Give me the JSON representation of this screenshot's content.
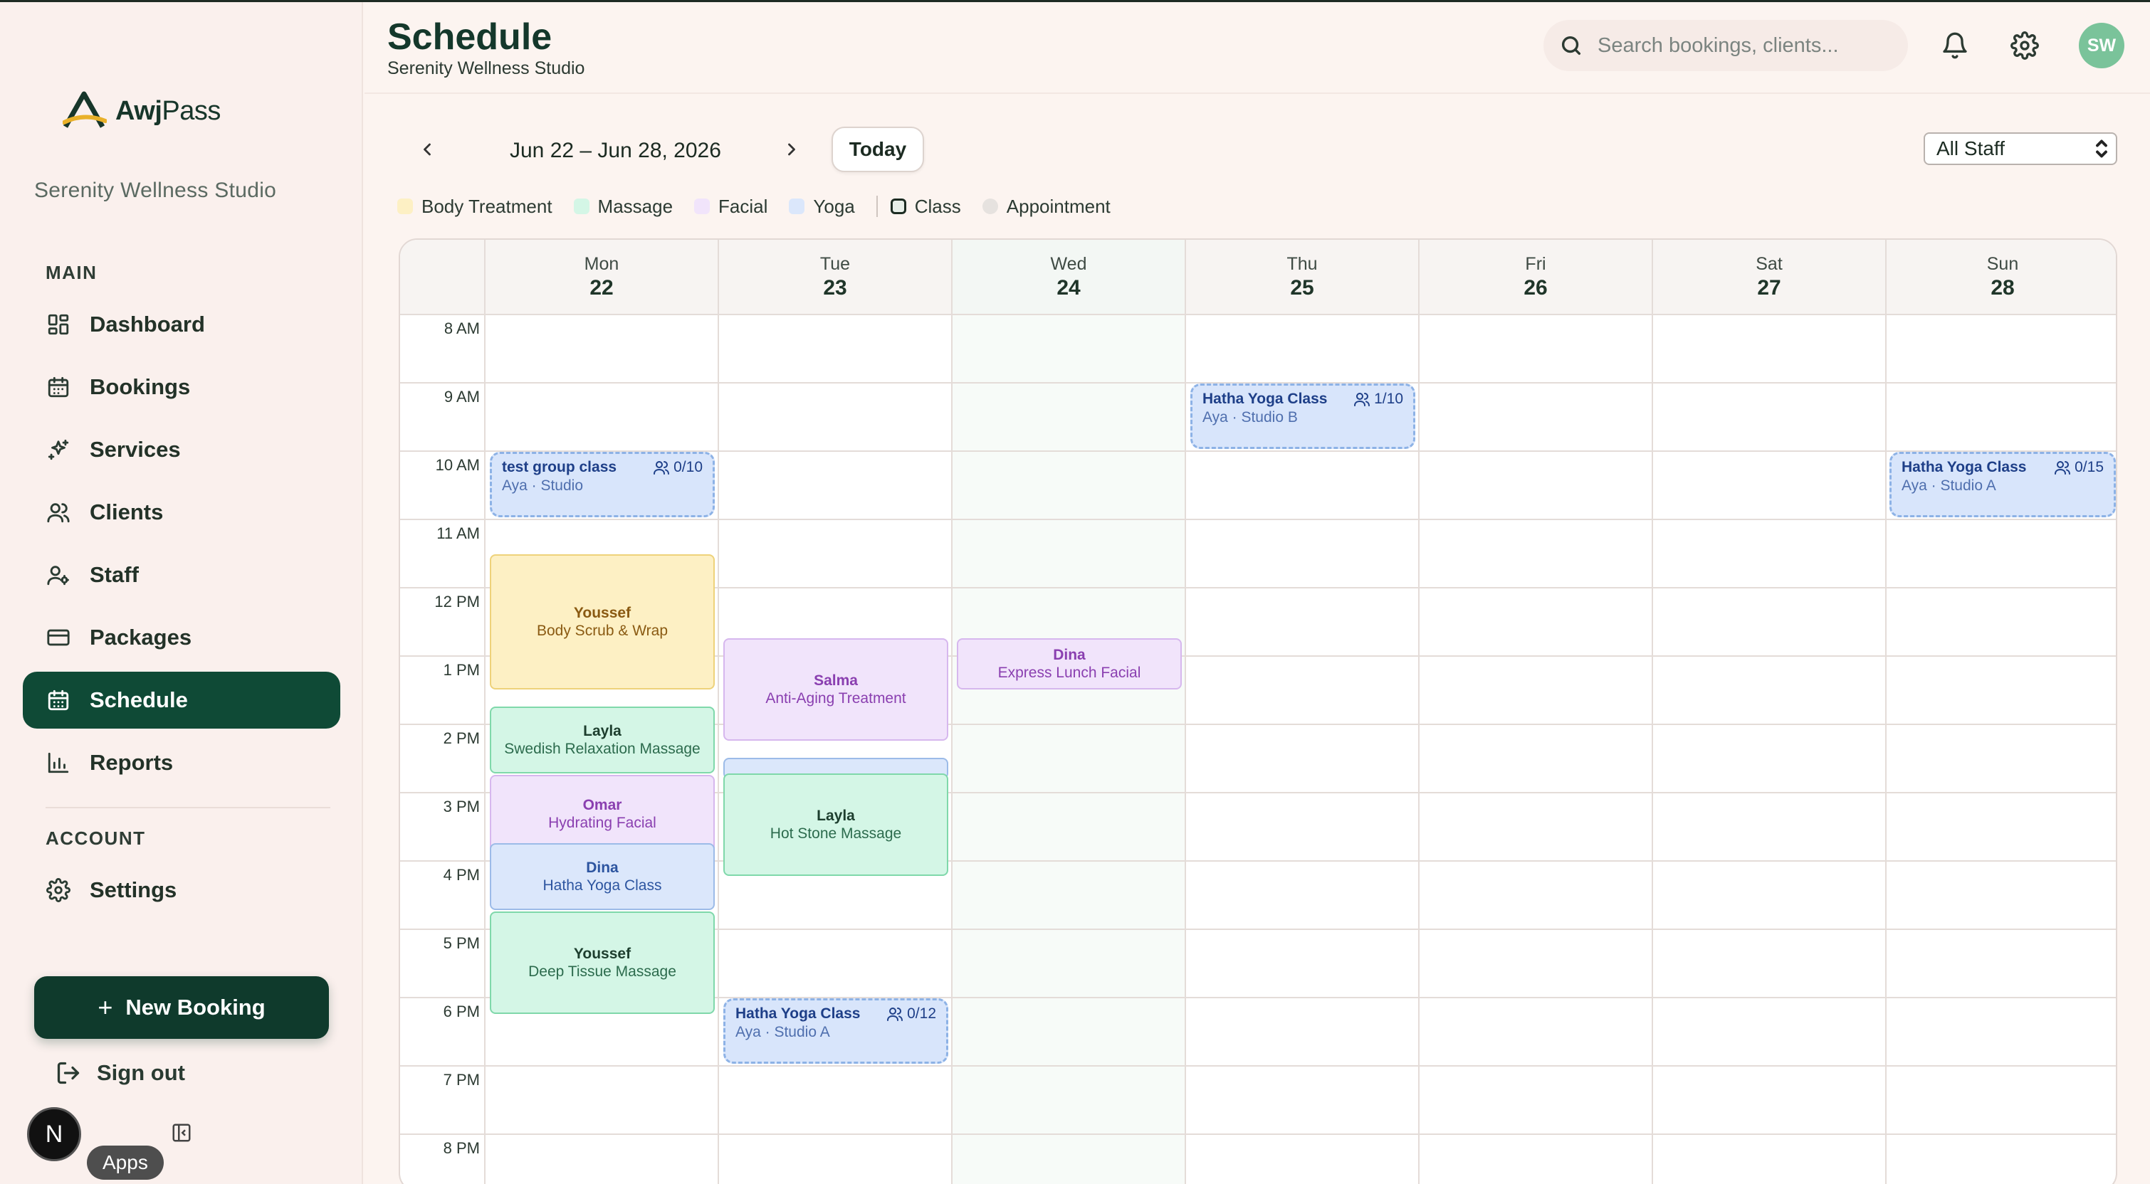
{
  "app": {
    "brand_bold": "Awj",
    "brand_light": "Pass",
    "studio_name": "Serenity Wellness Studio"
  },
  "sidebar": {
    "main_label": "MAIN",
    "account_label": "ACCOUNT",
    "items": [
      {
        "label": "Dashboard",
        "icon": "dashboard-icon"
      },
      {
        "label": "Bookings",
        "icon": "calendar-icon"
      },
      {
        "label": "Services",
        "icon": "sparkles-icon"
      },
      {
        "label": "Clients",
        "icon": "users-icon"
      },
      {
        "label": "Staff",
        "icon": "staff-icon"
      },
      {
        "label": "Packages",
        "icon": "card-icon"
      },
      {
        "label": "Schedule",
        "icon": "schedule-icon",
        "active": true
      },
      {
        "label": "Reports",
        "icon": "chart-icon"
      }
    ],
    "settings_label": "Settings",
    "new_booking_label": "New Booking",
    "sign_out_label": "Sign out",
    "n_badge": "N",
    "apps_tooltip": "Apps"
  },
  "header": {
    "title": "Schedule",
    "subtitle": "Serenity Wellness Studio",
    "search_placeholder": "Search bookings, clients...",
    "avatar_initials": "SW"
  },
  "toolbar": {
    "date_range": "Jun 22 – Jun 28, 2026",
    "today_label": "Today",
    "staff_filter": "All Staff"
  },
  "legend": [
    {
      "label": "Body Treatment",
      "color": "#fdf0c4"
    },
    {
      "label": "Massage",
      "color": "#d4f6e6"
    },
    {
      "label": "Facial",
      "color": "#f1e4fb"
    },
    {
      "label": "Yoga",
      "color": "#dbe7fb"
    },
    {
      "label": "Class",
      "color": "#e8efe9"
    },
    {
      "label": "Appointment",
      "color": "#e6e2df"
    }
  ],
  "calendar": {
    "days": [
      {
        "name": "Mon",
        "date": "22"
      },
      {
        "name": "Tue",
        "date": "23"
      },
      {
        "name": "Wed",
        "date": "24"
      },
      {
        "name": "Thu",
        "date": "25"
      },
      {
        "name": "Fri",
        "date": "26"
      },
      {
        "name": "Sat",
        "date": "27"
      },
      {
        "name": "Sun",
        "date": "28"
      }
    ],
    "times": [
      "8 AM",
      "9 AM",
      "10 AM",
      "11 AM",
      "12 PM",
      "1 PM",
      "2 PM",
      "3 PM",
      "4 PM",
      "5 PM",
      "6 PM",
      "7 PM",
      "8 PM"
    ],
    "classes": [
      {
        "title": "test group class",
        "capacity": "0/10",
        "sub": "Aya · Studio"
      },
      {
        "title": "Hatha Yoga Class",
        "capacity": "1/10",
        "sub": "Aya · Studio B"
      },
      {
        "title": "Hatha Yoga Class",
        "capacity": "0/15",
        "sub": "Aya · Studio A"
      },
      {
        "title": "Hatha Yoga Class",
        "capacity": "0/12",
        "sub": "Aya · Studio A"
      }
    ],
    "appointments": [
      {
        "who": "Youssef",
        "service": "Body Scrub & Wrap"
      },
      {
        "who": "Layla",
        "service": "Swedish Relaxation Massage"
      },
      {
        "who": "Omar",
        "service": "Hydrating Facial"
      },
      {
        "who": "Dina",
        "service": "Hatha Yoga Class"
      },
      {
        "who": "Youssef",
        "service": "Deep Tissue Massage"
      },
      {
        "who": "Salma",
        "service": "Anti-Aging Treatment"
      },
      {
        "who": "Layla",
        "service": "Hot Stone Massage"
      },
      {
        "who": "Dina",
        "service": "Express Lunch Facial"
      }
    ]
  }
}
